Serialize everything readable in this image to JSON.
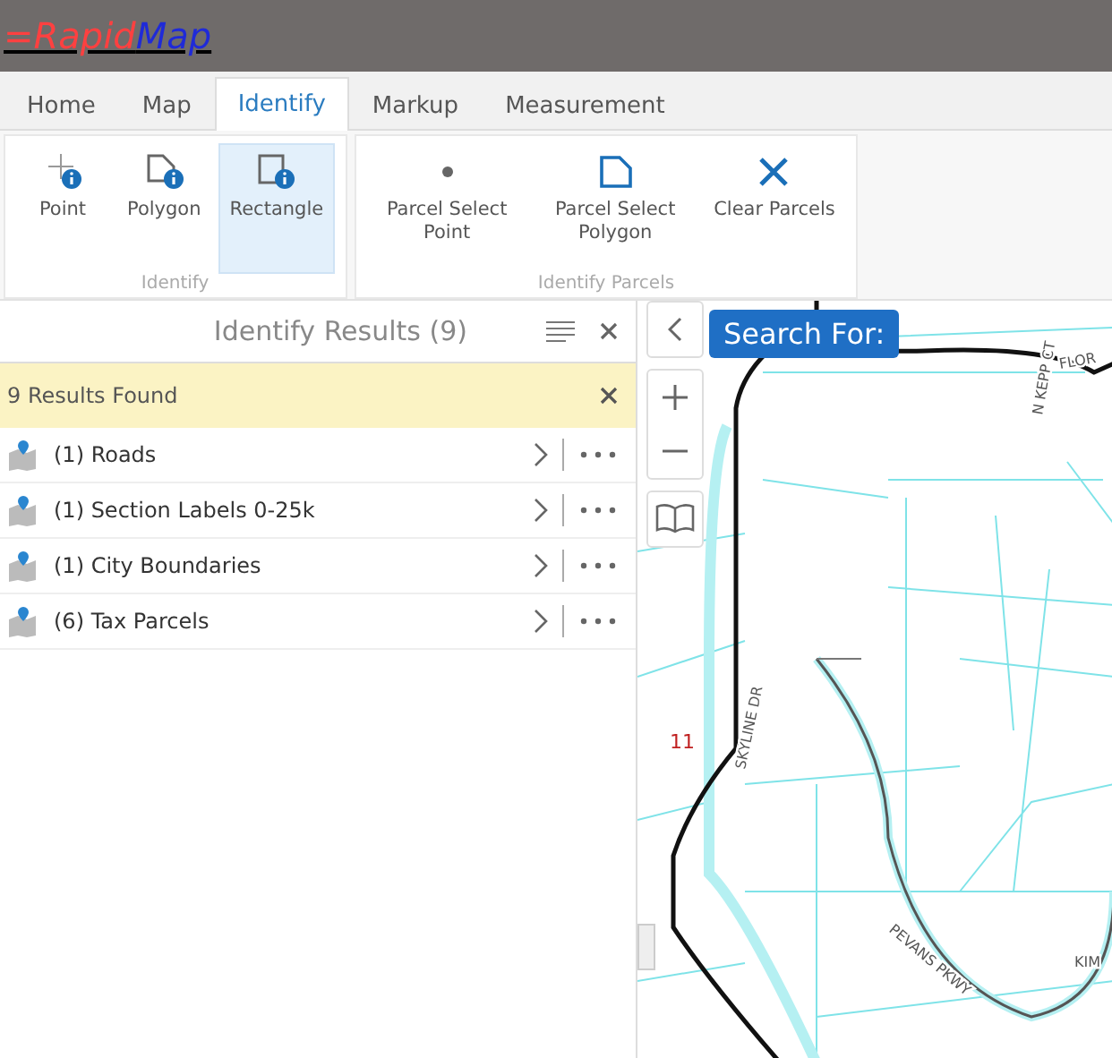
{
  "app": {
    "logo_part_1": "=Rapid",
    "logo_part_2": "Map"
  },
  "tabs": [
    {
      "label": "Home",
      "selected": false
    },
    {
      "label": "Map",
      "selected": false
    },
    {
      "label": "Identify",
      "selected": true
    },
    {
      "label": "Markup",
      "selected": false
    },
    {
      "label": "Measurement",
      "selected": false
    }
  ],
  "ribbon_groups": [
    {
      "title": "Identify",
      "tools": [
        {
          "kind": "point",
          "label": "Point",
          "selected": false
        },
        {
          "kind": "polygon",
          "label": "Polygon",
          "selected": false
        },
        {
          "kind": "rectangle",
          "label": "Rectangle",
          "selected": true
        }
      ]
    },
    {
      "title": "Identify Parcels",
      "tools": [
        {
          "kind": "dot",
          "label": "Parcel Select Point",
          "selected": false
        },
        {
          "kind": "shape",
          "label": "Parcel Select Polygon",
          "selected": false
        },
        {
          "kind": "clear",
          "label": "Clear Parcels",
          "selected": false
        }
      ]
    }
  ],
  "results_panel": {
    "title": "Identify Results (9)",
    "notice": "9 Results Found",
    "items": [
      {
        "label": "(1) Roads"
      },
      {
        "label": "(1) Section Labels 0-25k"
      },
      {
        "label": "(1) City Boundaries"
      },
      {
        "label": "(6) Tax Parcels"
      }
    ]
  },
  "map": {
    "search_label": "Search For:",
    "section_number": "11",
    "street_labels": [
      {
        "text": "N KEPP CT",
        "kind": "kepp"
      },
      {
        "text": "FLOR",
        "kind": "flor"
      },
      {
        "text": "SKYLINE DR",
        "kind": "skyline"
      },
      {
        "text": "PEVANS PKWY",
        "kind": "pevans"
      },
      {
        "text": "KIM",
        "kind": "kim"
      }
    ]
  }
}
